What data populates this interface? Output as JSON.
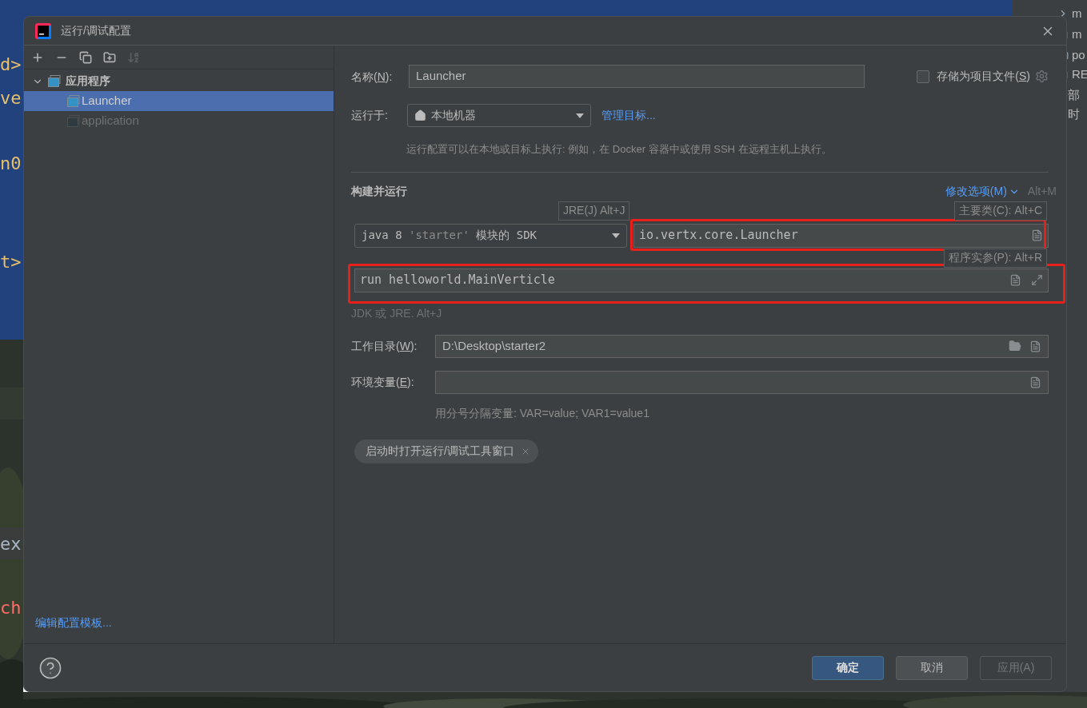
{
  "background": {
    "editor_fragments": [
      {
        "text": "d>",
        "color": "#e8bf6a"
      },
      {
        "text": "ve",
        "color": "#e8bf6a"
      },
      {
        "text": "n0",
        "color": "#e8bf6a"
      },
      {
        "text": "t>",
        "color": "#e8bf6a"
      },
      {
        "text": "ex",
        "color": "#a9b7c6"
      },
      {
        "text": "ch",
        "color": "#ff6b68"
      }
    ],
    "project_tree_fragments": [
      {
        "text": "m",
        "kind": "folder"
      },
      {
        "text": "m",
        "kind": "file"
      },
      {
        "text": "po",
        "kind": "maven"
      },
      {
        "text": "RE",
        "kind": "file"
      },
      {
        "text": "部",
        "kind": "plain"
      },
      {
        "text": "时",
        "kind": "plain"
      }
    ]
  },
  "window": {
    "title": "运行/调试配置"
  },
  "toolbar": [
    {
      "kind": "add",
      "disabled": false
    },
    {
      "kind": "remove",
      "disabled": false
    },
    {
      "kind": "copy",
      "disabled": false
    },
    {
      "kind": "folder",
      "disabled": false
    },
    {
      "kind": "sort",
      "disabled": true
    }
  ],
  "tree": [
    {
      "label": "应用程序",
      "expanded": true,
      "children": [
        {
          "label": "Launcher",
          "selected": true,
          "dimmed": false
        },
        {
          "label": "application",
          "selected": false,
          "dimmed": true
        }
      ]
    }
  ],
  "sidebar_link": "编辑配置模板...",
  "name": {
    "label": [
      "名称(",
      "N",
      "):"
    ],
    "value": "Launcher"
  },
  "store_as_file": {
    "label": [
      "存储为项目文件(",
      "S",
      ")"
    ],
    "checked": false
  },
  "run_on": {
    "label": "运行于:",
    "value": "本地机器",
    "link": "管理目标..."
  },
  "run_on_hint": "运行配置可以在本地或目标上执行: 例如，在 Docker 容器中或使用 SSH 在远程主机上执行。",
  "section": {
    "title": "构建并运行",
    "modify_link": "修改选项(M)",
    "shortcut": "Alt+M"
  },
  "tooltips": {
    "jre": "JRE(J) Alt+J",
    "main_class": "主要类(C): Alt+C",
    "program_args": "程序实参(P): Alt+R"
  },
  "sdk": {
    "version": "java 8",
    "module": "'starter'",
    "suffix": "模块的 SDK"
  },
  "main_class": {
    "value": "io.vertx.core.Launcher",
    "highlighted": true
  },
  "program_args": {
    "value": "run helloworld.MainVerticle",
    "highlighted": true
  },
  "jdk_hint": "JDK 或 JRE. Alt+J",
  "working_dir": {
    "label": [
      "工作目录(",
      "W",
      "):"
    ],
    "value": "D:\\Desktop\\starter2"
  },
  "env": {
    "label": [
      "环境变量(",
      "E",
      "):"
    ]
  },
  "env_hint": "用分号分隔变量: VAR=value; VAR1=value1",
  "chips": [
    {
      "label": "启动时打开运行/调试工具窗口"
    }
  ],
  "buttons": [
    {
      "label": "确定",
      "kind": "default",
      "disabled": false
    },
    {
      "label": "取消",
      "kind": "normal",
      "disabled": false
    },
    {
      "label": "应用(A)",
      "kind": "normal",
      "disabled": true
    }
  ]
}
